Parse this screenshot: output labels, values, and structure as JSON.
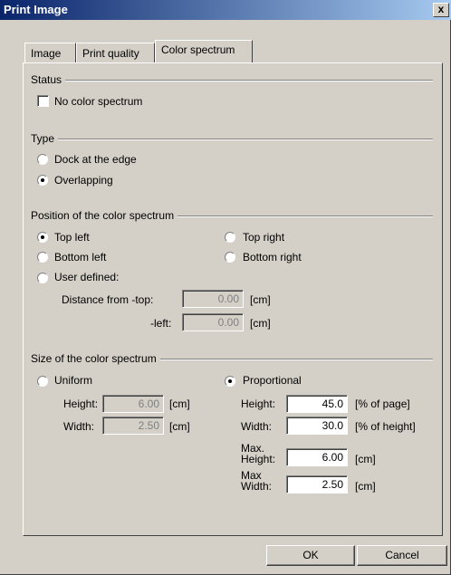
{
  "window": {
    "title": "Print Image",
    "close_symbol": "x"
  },
  "tabs": [
    {
      "label": "Image",
      "active": false
    },
    {
      "label": "Print quality",
      "active": false
    },
    {
      "label": "Color spectrum",
      "active": true
    }
  ],
  "status": {
    "title": "Status",
    "no_spectrum_label": "No color spectrum",
    "no_spectrum_checked": false
  },
  "type": {
    "title": "Type",
    "options": [
      {
        "label": "Dock at the edge",
        "selected": false
      },
      {
        "label": "Overlapping",
        "selected": true
      }
    ]
  },
  "position": {
    "title": "Position of the color spectrum",
    "options": {
      "top_left": {
        "label": "Top left",
        "selected": true
      },
      "top_right": {
        "label": "Top right",
        "selected": false
      },
      "bottom_left": {
        "label": "Bottom left",
        "selected": false
      },
      "bottom_right": {
        "label": "Bottom right",
        "selected": false
      },
      "user_defined": {
        "label": "User defined:",
        "selected": false
      }
    },
    "distance_top_label": "Distance from -top:",
    "distance_top_value": "0.00",
    "distance_left_label": "-left:",
    "distance_left_value": "0.00",
    "unit": "[cm]"
  },
  "size": {
    "title": "Size of the color spectrum",
    "uniform": {
      "label": "Uniform",
      "selected": false,
      "height_label": "Height:",
      "height_value": "6.00",
      "width_label": "Width:",
      "width_value": "2.50",
      "unit": "[cm]"
    },
    "proportional": {
      "label": "Proportional",
      "selected": true,
      "height_label": "Height:",
      "height_value": "45.0",
      "height_unit": "[% of page]",
      "width_label": "Width:",
      "width_value": "30.0",
      "width_unit": "[% of height]",
      "max_height_label_1": "Max.",
      "max_height_label_2": "Height:",
      "max_height_value": "6.00",
      "max_height_unit": "[cm]",
      "max_width_label_1": "Max",
      "max_width_label_2": "Width:",
      "max_width_value": "2.50",
      "max_width_unit": "[cm]"
    }
  },
  "buttons": {
    "ok": "OK",
    "cancel": "Cancel"
  }
}
